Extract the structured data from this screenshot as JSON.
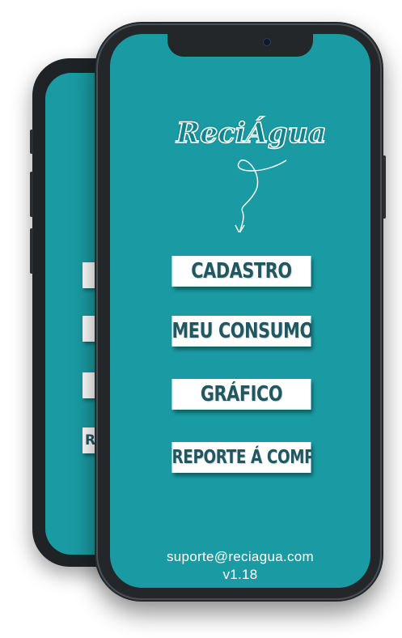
{
  "app": {
    "logo_text": "ReciÁgua"
  },
  "menu": {
    "items": [
      {
        "label": "CADASTRO"
      },
      {
        "label": "MEU CONSUMO"
      },
      {
        "label": "GRÁFICO"
      },
      {
        "label": "REPORTE Á COMPESA"
      }
    ]
  },
  "back_phone": {
    "visible_fragment": "R"
  },
  "footer": {
    "email": "suporte@reciagua.com",
    "version": "v1.18"
  },
  "colors": {
    "screen_background": "#1a9ba3",
    "button_background": "#ffffff",
    "button_text": "#1f5860",
    "phone_frame": "#23272a"
  },
  "icons": {
    "logo_arrow": "swirl-arrow-down-icon"
  }
}
